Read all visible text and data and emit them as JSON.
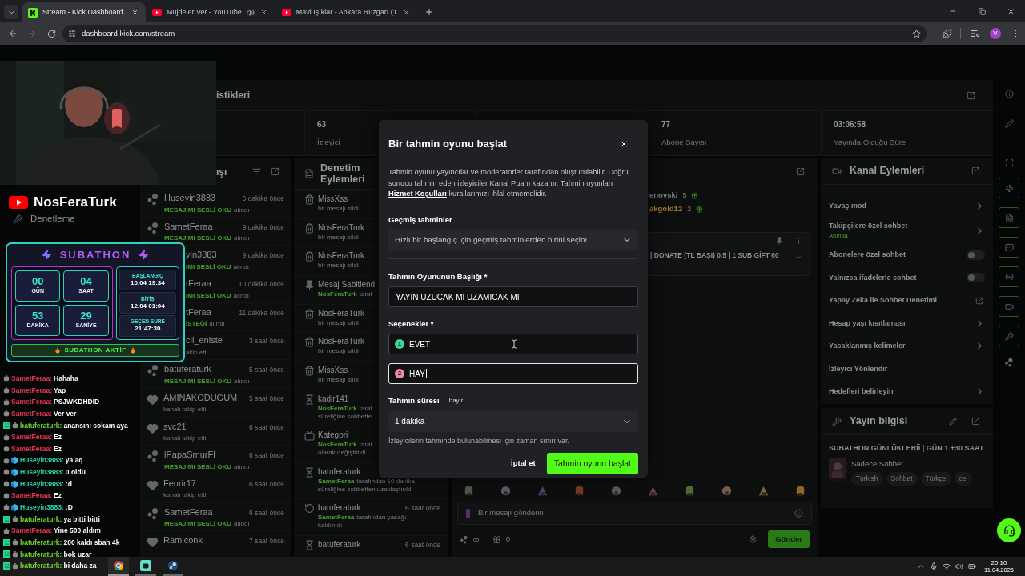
{
  "browser": {
    "tabs": [
      {
        "title": "Stream - Kick Dashboard",
        "kind": "kick",
        "selected": true,
        "audio": false
      },
      {
        "title": "Müjdeler Ver - YouTube",
        "kind": "youtube",
        "selected": false,
        "audio": true
      },
      {
        "title": "Mavi Işıklar - Ankara Rüzgarı (1",
        "kind": "youtube",
        "selected": false,
        "audio": false
      }
    ],
    "address": "dashboard.kick.com/stream",
    "profile_initial": "V"
  },
  "sidebar": {
    "items": [
      {
        "label": "Denetleme"
      }
    ]
  },
  "stats": {
    "title": "istikleri",
    "items": [
      {
        "value": "63",
        "label": "İzleyici"
      },
      {
        "value": "77",
        "label": "Abone Sayısı"
      },
      {
        "value": "03:06:58",
        "label": "Yayında Olduğu Süre"
      }
    ]
  },
  "activity": {
    "title": "ışı",
    "rows": [
      {
        "kind": "reward",
        "name": "Huseyin3883",
        "time": "6 dakika önce",
        "highlight": "MESAJIMI SESLİ OKU",
        "detail": "alındı"
      },
      {
        "kind": "reward",
        "name": "SametFeraa",
        "time": "9 dakika önce",
        "highlight": "MESAJIMI SESLİ OKU",
        "detail": "alındı"
      },
      {
        "kind": "covered",
        "name": "yin3883",
        "time": "9 dakika önce",
        "highlight": "IMI SESLİ OKU",
        "detail": "alındı"
      },
      {
        "kind": "covered",
        "name": "tFeraa",
        "time": "10 dakika önce",
        "highlight": "IMI SESLİ OKU",
        "detail": "alındı"
      },
      {
        "kind": "covered",
        "name": "tFeraa",
        "time": "11 dakika önce",
        "highlight": "İSTEĞİ",
        "detail": "alındı"
      },
      {
        "kind": "covered",
        "name": "cli_eniste",
        "time": "3 saat önce",
        "detail": "akip etti"
      },
      {
        "kind": "reward",
        "name": "batuferaturk",
        "time": "5 saat önce",
        "highlight": "MESAJIMI SESLİ OKU",
        "detail": "alındı"
      },
      {
        "kind": "follow",
        "name": "AMINAKODUGUM",
        "time": "5 saat önce",
        "detail": "kanalı takip etti"
      },
      {
        "kind": "follow",
        "name": "svc21",
        "time": "6 saat önce",
        "detail": "kanalı takip etti"
      },
      {
        "kind": "reward",
        "name": "lPapaSmurFl",
        "time": "6 saat önce",
        "highlight": "MESAJIMI SESLİ OKU",
        "detail": "alındı"
      },
      {
        "kind": "follow",
        "name": "Fenrir17",
        "time": "6 saat önce",
        "detail": "kanalı takip etti"
      },
      {
        "kind": "reward",
        "name": "SametFeraa",
        "time": "6 saat önce",
        "highlight": "MESAJIMI SESLİ OKU",
        "detail": "alındı"
      },
      {
        "kind": "follow",
        "name": "Ramiconk",
        "time": "7 saat önce"
      }
    ]
  },
  "moderation": {
    "title": "Denetim Eylemleri",
    "rows": [
      {
        "kind": "trash",
        "name": "MissXss",
        "lines": [
          {
            "text": "bir mesajı sildi"
          }
        ]
      },
      {
        "kind": "trash",
        "name": "NosFeraTurk",
        "lines": [
          {
            "text": "bir mesajı sildi"
          }
        ]
      },
      {
        "kind": "trash",
        "name": "NosFeraTurk",
        "lines": [
          {
            "text": "bir mesajı sildi"
          }
        ]
      },
      {
        "kind": "pin",
        "name": "Mesaj Sabitlend",
        "lines": [
          {
            "actor": "NosFeraTurk",
            "text": "taraf"
          }
        ]
      },
      {
        "kind": "trash",
        "name": "NosFeraTurk",
        "lines": [
          {
            "text": "bir mesajı sildi"
          }
        ]
      },
      {
        "kind": "trash",
        "name": "NosFeraTurk",
        "lines": [
          {
            "text": "bir mesajı sildi"
          }
        ]
      },
      {
        "kind": "trash",
        "name": "MissXss",
        "lines": [
          {
            "text": "bir mesajı sildi"
          }
        ]
      },
      {
        "kind": "hourglass",
        "name": "kadir141",
        "lines": [
          {
            "actor": "NosFeraTurk",
            "text": "taraf"
          },
          {
            "text": "süreliğine sohbette"
          }
        ]
      },
      {
        "kind": "category",
        "name": "Kategori",
        "lines": [
          {
            "actor": "NosFeraTurk",
            "text": "taraf"
          },
          {
            "text": "olarak değiştirildi"
          }
        ]
      },
      {
        "kind": "hourglass",
        "name": "batuferaturk",
        "lines": [
          {
            "actor": "SametFeraa",
            "text": "tarafından 10 dakika"
          },
          {
            "text": "süreliğine sohbetten uzaklaştırıldı"
          }
        ]
      },
      {
        "kind": "restore",
        "name": "batuferaturk",
        "time": "6 saat önce",
        "lines": [
          {
            "actor": "SametFeraa",
            "text": "tarafından yasağı"
          },
          {
            "text": "kaldırıldı"
          }
        ]
      },
      {
        "kind": "hourglass",
        "name": "batuferaturk",
        "time": "6 saat önce",
        "lines": []
      }
    ]
  },
  "chat": {
    "leaderboard": [
      {
        "name": "enovski",
        "count": "5",
        "color": "#7a7d80"
      },
      {
        "name": "akgold12",
        "count": "2",
        "color": "#a8742c"
      }
    ],
    "pinned": "| DONATE (TL BAŞI) 0.5 | 1 SUB GİFT 60",
    "placeholder": "Bir mesajı gönderin",
    "points": "∞",
    "gifts": "0",
    "send": "Gönder"
  },
  "channel_actions": {
    "title": "Kanal Eylemleri",
    "items": [
      {
        "label": "Yavaş mod",
        "kind": "link"
      },
      {
        "label": "Takipçilere özel sohbet",
        "sub": "Anında",
        "kind": "link"
      },
      {
        "label": "Abonelere özel sohbet",
        "kind": "toggle",
        "on": false
      },
      {
        "label": "Yalnızca ifadelerle sohbet",
        "kind": "toggle",
        "on": false
      },
      {
        "label": "Yapay Zeka ile Sohbet Denetimi",
        "kind": "external"
      },
      {
        "label": "Hesap yaşı kısıtlaması",
        "kind": "link"
      },
      {
        "label": "Yasaklanmış kelimeler",
        "kind": "link"
      },
      {
        "label": "İzleyici Yönlendir",
        "kind": "plain"
      },
      {
        "label": "Hedefleri belirleyin",
        "kind": "link"
      }
    ]
  },
  "stream_info": {
    "title": "Yayın bilgisi",
    "stream_title": "SUBATHON GÜNLÜKLERİİ | GÜN 1 +30 SAAT",
    "category": "Sadece Sohbet",
    "tags": [
      "Turkish",
      "Sohbet",
      "Türkçe",
      "cel"
    ]
  },
  "overlay": {
    "channel": "NosFeraTurk",
    "subathon": {
      "title": "SUBATHON",
      "units": [
        {
          "value": "00",
          "label": "GÜN"
        },
        {
          "value": "04",
          "label": "SAAT"
        },
        {
          "value": "53",
          "label": "DAKİKA"
        },
        {
          "value": "29",
          "label": "SANİYE"
        }
      ],
      "info": [
        {
          "label": "BAŞLANGIÇ",
          "value": "10.04 19:34"
        },
        {
          "label": "BİTİŞ",
          "value": "12.04 01:04"
        },
        {
          "label": "GEÇEN SÜRE",
          "value": "21:47:30"
        }
      ],
      "status": "SUBATHON AKTİF"
    },
    "chat": [
      {
        "user": "SametFeraa:",
        "text": "Hahaha",
        "color": "#e8334f",
        "badges": [
          {
            "kind": "robot"
          }
        ]
      },
      {
        "user": "SametFeraa:",
        "text": "Yap",
        "color": "#e8334f",
        "badges": [
          {
            "kind": "robot"
          }
        ]
      },
      {
        "user": "SametFeraa:",
        "text": "PSJWKDHDID",
        "color": "#e8334f",
        "badges": [
          {
            "kind": "robot"
          }
        ]
      },
      {
        "user": "SametFeraa:",
        "text": "Ver ver",
        "color": "#e8334f",
        "badges": [
          {
            "kind": "robot"
          }
        ]
      },
      {
        "user": "batuferaturk:",
        "text": "anansını sokam aya",
        "color": "#72d82a",
        "badges": [
          {
            "kind": "grid"
          },
          {
            "kind": "robot"
          }
        ]
      },
      {
        "user": "SametFeraa:",
        "text": "Ez",
        "color": "#e8334f",
        "badges": [
          {
            "kind": "robot"
          }
        ]
      },
      {
        "user": "SametFeraa:",
        "text": "Ez",
        "color": "#e8334f",
        "badges": [
          {
            "kind": "robot"
          }
        ]
      },
      {
        "user": "Huseyin3883:",
        "text": "ya aq",
        "color": "#2ad0a6",
        "badges": [
          {
            "kind": "robot"
          },
          {
            "kind": "cube"
          }
        ]
      },
      {
        "user": "Huseyin3883:",
        "text": "0 oldu",
        "color": "#2ad0a6",
        "badges": [
          {
            "kind": "robot"
          },
          {
            "kind": "cube"
          }
        ]
      },
      {
        "user": "Huseyin3883:",
        "text": ":d",
        "color": "#2ad0a6",
        "badges": [
          {
            "kind": "robot"
          },
          {
            "kind": "cube"
          }
        ]
      },
      {
        "user": "SametFeraa:",
        "text": "Ez",
        "color": "#e8334f",
        "badges": [
          {
            "kind": "robot"
          }
        ]
      },
      {
        "user": "Huseyin3883:",
        "text": ":D",
        "color": "#2ad0a6",
        "badges": [
          {
            "kind": "robot"
          },
          {
            "kind": "cube"
          }
        ]
      },
      {
        "user": "batuferaturk:",
        "text": "ya bitti bitti",
        "color": "#72d82a",
        "badges": [
          {
            "kind": "grid"
          },
          {
            "kind": "robot"
          }
        ]
      },
      {
        "user": "SametFeraa:",
        "text": "Yine 500 aldım",
        "color": "#e8334f",
        "badges": [
          {
            "kind": "robot"
          }
        ]
      },
      {
        "user": "batuferaturk:",
        "text": "200 kaldı sbah 4k",
        "color": "#72d82a",
        "badges": [
          {
            "kind": "grid"
          },
          {
            "kind": "robot"
          }
        ]
      },
      {
        "user": "batuferaturk:",
        "text": "bok uzar",
        "color": "#72d82a",
        "badges": [
          {
            "kind": "grid"
          },
          {
            "kind": "robot"
          }
        ]
      },
      {
        "user": "batuferaturk:",
        "text": "bi daha za",
        "color": "#72d82a",
        "badges": [
          {
            "kind": "grid"
          },
          {
            "kind": "robot"
          }
        ]
      }
    ]
  },
  "modal": {
    "title": "Bir tahmin oyunu başlat",
    "intro_before": "Tahmin oyunu yayıncılar ve moderatörler tarafından oluşturulabilir. Doğru sonucu tahmin eden izleyiciler Kanal Puanı kazanır. Tahmin oyunları",
    "intro_link": "Hizmet Koşulları",
    "intro_after": "kurallarımızı ihlal etmemelidir.",
    "history": {
      "label": "Geçmiş tahminler",
      "placeholder": "Hızlı bir başlangıç için geçmiş tahminlerden birini seçin!"
    },
    "title_field": {
      "label": "Tahmin Oyununun Başlığı *",
      "value": "YAYIN UZUCAK MI UZAMICAK MI"
    },
    "options": {
      "label": "Seçenekler *",
      "items": [
        {
          "number": "1",
          "value": "EVET",
          "color": "#3fd597",
          "focused": false
        },
        {
          "number": "2",
          "value": "HAY",
          "color": "#f28aa6",
          "focused": true
        }
      ]
    },
    "duration": {
      "label": "Tahmin süresi",
      "suggestion": "hayır",
      "value": "1 dakika",
      "hint": "İzleyicilerin tahminde bulunabilmesi için zaman sınırı var."
    },
    "cancel": "İptal et",
    "submit": "Tahmin oyunu başlat"
  },
  "taskbar": {
    "time": "20:10",
    "date": "11.04.2026"
  }
}
